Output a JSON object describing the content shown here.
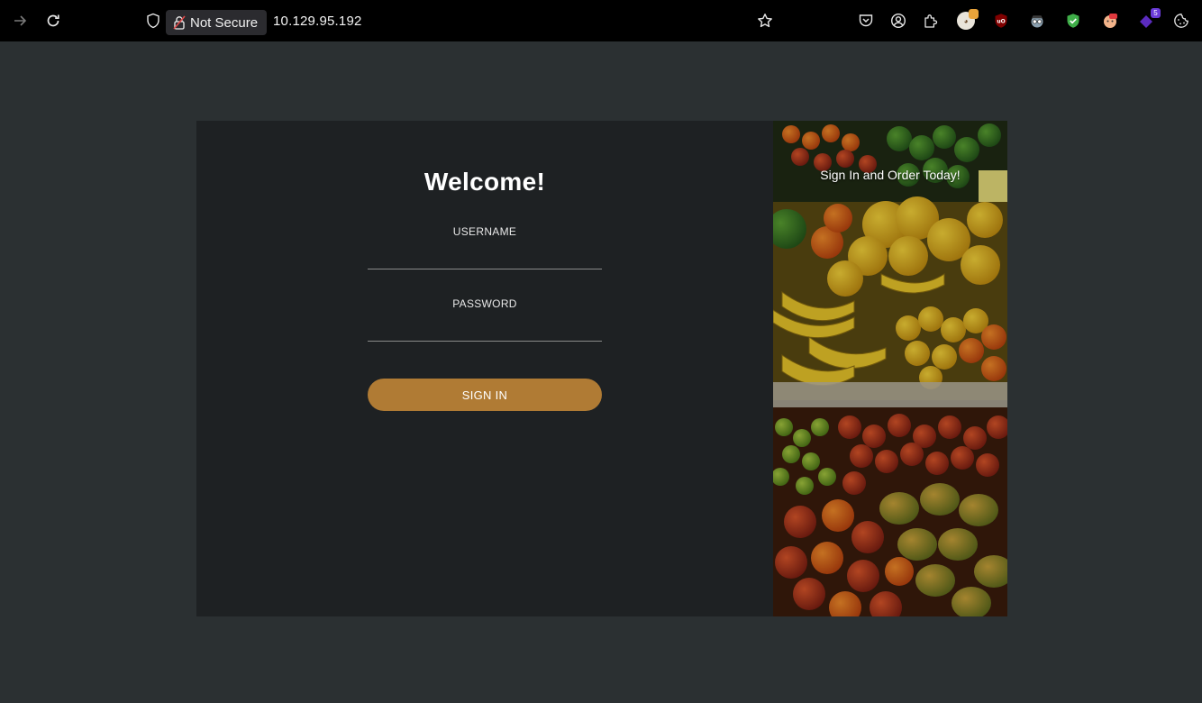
{
  "browser": {
    "security_label": "Not Secure",
    "url": "10.129.95.192",
    "extensions": [
      {
        "name": "pocket",
        "badge": ""
      },
      {
        "name": "account",
        "badge": ""
      },
      {
        "name": "extensions",
        "badge": ""
      },
      {
        "name": "cookie-editor",
        "badge": ""
      },
      {
        "name": "ublock",
        "badge": ""
      },
      {
        "name": "detective",
        "badge": ""
      },
      {
        "name": "shield-check",
        "badge": ""
      },
      {
        "name": "fox-ext",
        "badge": ""
      },
      {
        "name": "purple-ext",
        "badge": "5"
      },
      {
        "name": "cookie",
        "badge": ""
      }
    ]
  },
  "login": {
    "title": "Welcome!",
    "username_label": "USERNAME",
    "username_value": "",
    "password_label": "PASSWORD",
    "password_value": "",
    "submit_label": "SIGN IN"
  },
  "promo": {
    "tagline": "Sign In and Order Today!"
  },
  "colors": {
    "page_bg": "#2b3032",
    "panel_bg": "#1e2123",
    "accent": "#b07b34"
  }
}
